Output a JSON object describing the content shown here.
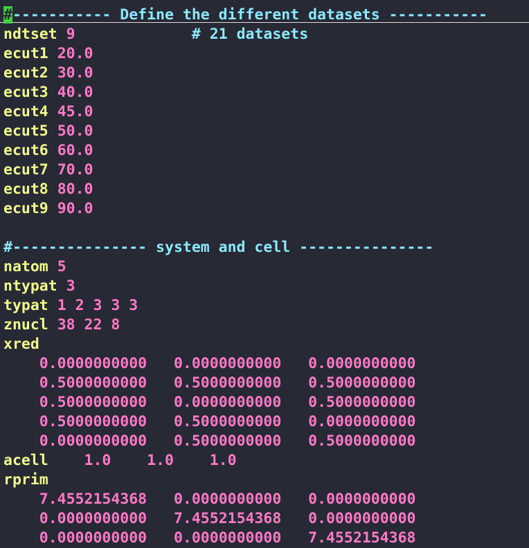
{
  "header_comment": {
    "cursor_char": "#",
    "rest": "----------- Define the different datasets -----------"
  },
  "datasets": {
    "ndtset": {
      "key": "ndtset",
      "value": "9",
      "comment": "# 21 datasets"
    },
    "ecuts": [
      {
        "key": "ecut1",
        "value": "20.0"
      },
      {
        "key": "ecut2",
        "value": "30.0"
      },
      {
        "key": "ecut3",
        "value": "40.0"
      },
      {
        "key": "ecut4",
        "value": "45.0"
      },
      {
        "key": "ecut5",
        "value": "50.0"
      },
      {
        "key": "ecut6",
        "value": "60.0"
      },
      {
        "key": "ecut7",
        "value": "70.0"
      },
      {
        "key": "ecut8",
        "value": "80.0"
      },
      {
        "key": "ecut9",
        "value": "90.0"
      }
    ]
  },
  "system_comment": "#--------------- system and cell ---------------",
  "system": {
    "natom": {
      "key": "natom",
      "value": "5"
    },
    "ntypat": {
      "key": "ntypat",
      "value": "3"
    },
    "typat": {
      "key": "typat",
      "value": "1 2 3 3 3"
    },
    "znucl": {
      "key": "znucl",
      "value": "38 22 8"
    },
    "xred_key": "xred",
    "xred": [
      [
        "0.0000000000",
        "0.0000000000",
        "0.0000000000"
      ],
      [
        "0.5000000000",
        "0.5000000000",
        "0.5000000000"
      ],
      [
        "0.5000000000",
        "0.0000000000",
        "0.5000000000"
      ],
      [
        "0.5000000000",
        "0.5000000000",
        "0.0000000000"
      ],
      [
        "0.0000000000",
        "0.5000000000",
        "0.5000000000"
      ]
    ],
    "acell": {
      "key": "acell",
      "values": [
        "1.0",
        "1.0",
        "1.0"
      ]
    },
    "rprim_key": "rprim",
    "rprim": [
      [
        "7.4552154368",
        "0.0000000000",
        "0.0000000000"
      ],
      [
        "0.0000000000",
        "7.4552154368",
        "0.0000000000"
      ],
      [
        "0.0000000000",
        "0.0000000000",
        "7.4552154368"
      ]
    ]
  },
  "colors": {
    "background": "#272935",
    "comment": "#8be9fd",
    "keyword": "#f1fa8c",
    "number": "#ff79c6",
    "cursor": "#3ed13e"
  }
}
